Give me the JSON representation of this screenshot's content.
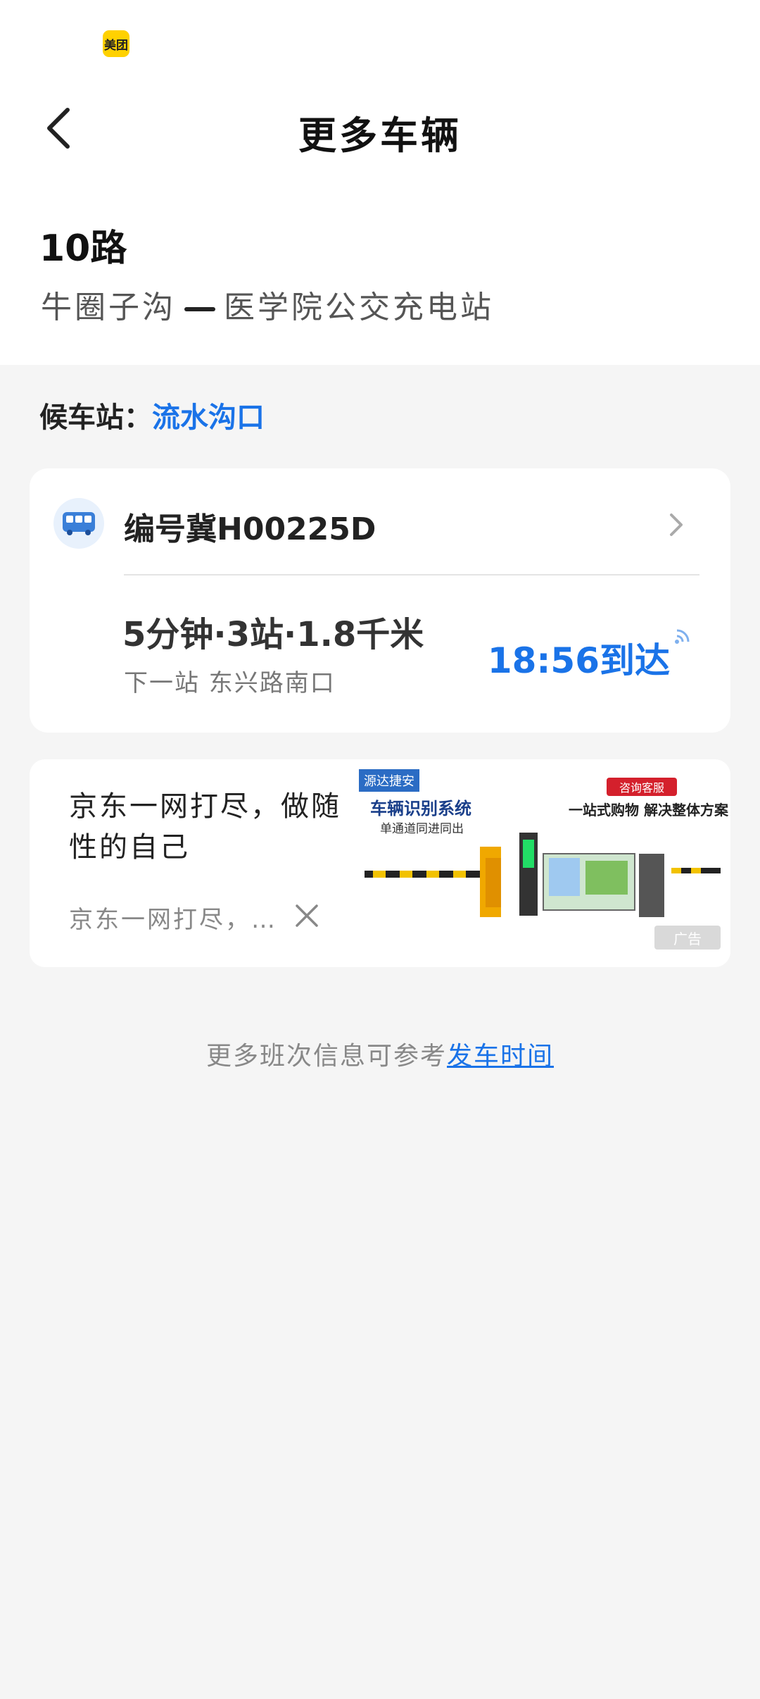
{
  "status_bar": {
    "app_badge": "美团"
  },
  "header": {
    "title": "更多车辆"
  },
  "route": {
    "name": "10路",
    "from": "牛圈子沟",
    "to": "医学院公交充电站"
  },
  "stop": {
    "label": "候车站：",
    "name": "流水沟口"
  },
  "bus": {
    "plate": "编号冀H00225D",
    "eta_summary": "5分钟·3站·1.8千米",
    "next_stop": "下一站 东兴路南口",
    "arrival": "18:56到达"
  },
  "ad": {
    "headline": "京东一网打尽，做随性的自己",
    "subtext": "京东一网打尽，…",
    "image_brand": "源达捷安",
    "image_title": "车辆识别系统",
    "image_subtitle": "单通道同进同出",
    "image_badge": "咨询客服",
    "image_slogan": "一站式购物 解决整体方案",
    "tag": "广告"
  },
  "footer": {
    "prefix": "更多班次信息可参考",
    "link": "发车时间"
  },
  "colors": {
    "accent": "#1a73e8",
    "badge": "#ffd100"
  }
}
